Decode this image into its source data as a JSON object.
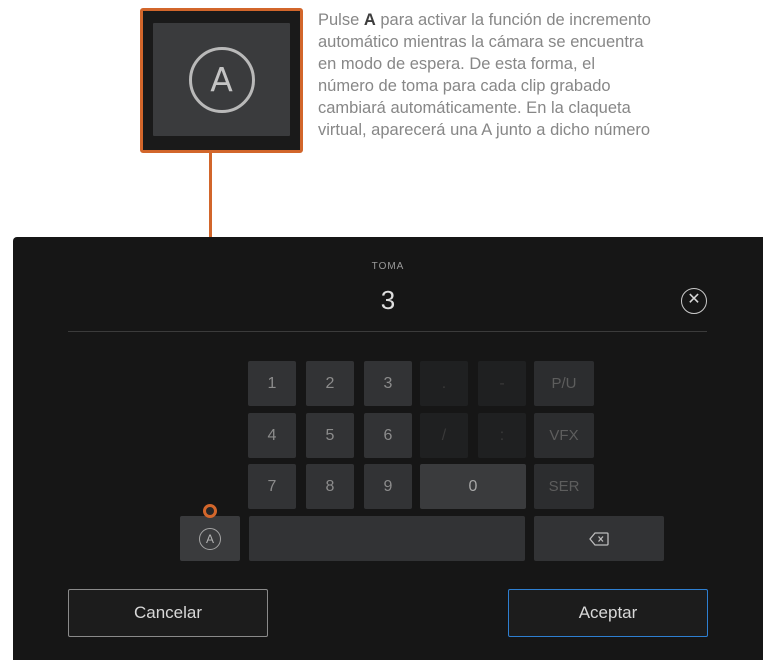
{
  "callout": {
    "icon_letter": "A",
    "description_before": "Pulse ",
    "description_bold": "A",
    "description_after": " para activar la función de incremento\nautomático mientras la cámara se encuentra\nen modo de espera. De esta forma, el\nnúmero de toma para cada clip grabado\ncambiará automáticamente. En la claqueta\nvirtual, aparecerá una A junto a dicho número"
  },
  "field": {
    "label": "TOMA",
    "value": "3"
  },
  "keypad": {
    "digits": [
      "1",
      "2",
      "3",
      "4",
      "5",
      "6",
      "7",
      "8",
      "9"
    ],
    "dim_keys": [
      ".",
      "-",
      "/",
      ":"
    ],
    "zero": "0",
    "labels": [
      "P/U",
      "VFX",
      "SER"
    ],
    "auto_increment": "A"
  },
  "actions": {
    "cancel": "Cancelar",
    "accept": "Aceptar"
  },
  "colors": {
    "callout_orange": "#d2662b",
    "accept_border": "#2e7fd1",
    "screen_bg": "#161616"
  }
}
